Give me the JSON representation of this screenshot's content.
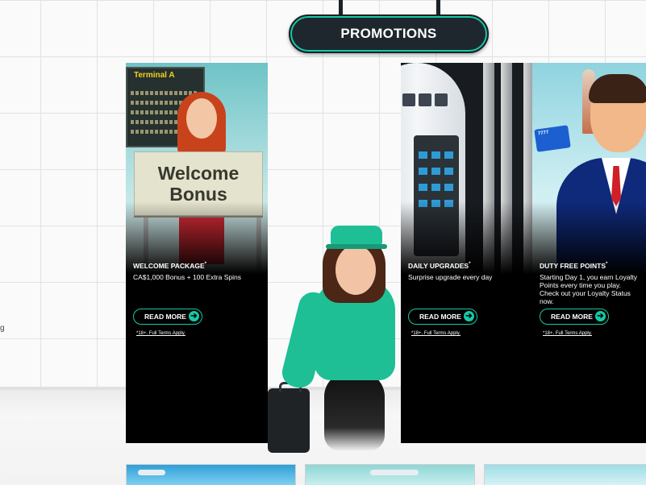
{
  "header": {
    "title": "PROMOTIONS"
  },
  "edge_text": "g",
  "cards": [
    {
      "id": "welcome",
      "image": {
        "board_label": "Terminal A",
        "sign_line1": "Welcome",
        "sign_line2": "Bonus"
      },
      "title": "WELCOME PACKAGE",
      "title_mark": "*",
      "description": "CA$1,000 Bonus + 100 Extra Spins",
      "button_label": "READ MORE",
      "terms": "*18+. Full Terms Apply."
    },
    {
      "id": "daily",
      "title": "DAILY UPGRADES",
      "title_mark": "*",
      "description": "Surprise upgrade every day",
      "button_label": "READ MORE",
      "terms": "*18+. Full Terms Apply."
    },
    {
      "id": "dutyfree",
      "image": {
        "card_label": "7777"
      },
      "title": "DUTY FREE POINTS",
      "title_mark": "*",
      "description": "Starting Day 1, you earn Loyalty Points every time you play. Check out your Loyalty Status now.",
      "button_label": "READ MORE",
      "terms": "*18+. Full Terms Apply."
    }
  ],
  "icons": {
    "button_arrow": "➔"
  },
  "colors": {
    "accent": "#17c9a6",
    "sign_bg": "#1e272d",
    "card_bg": "#000000"
  }
}
